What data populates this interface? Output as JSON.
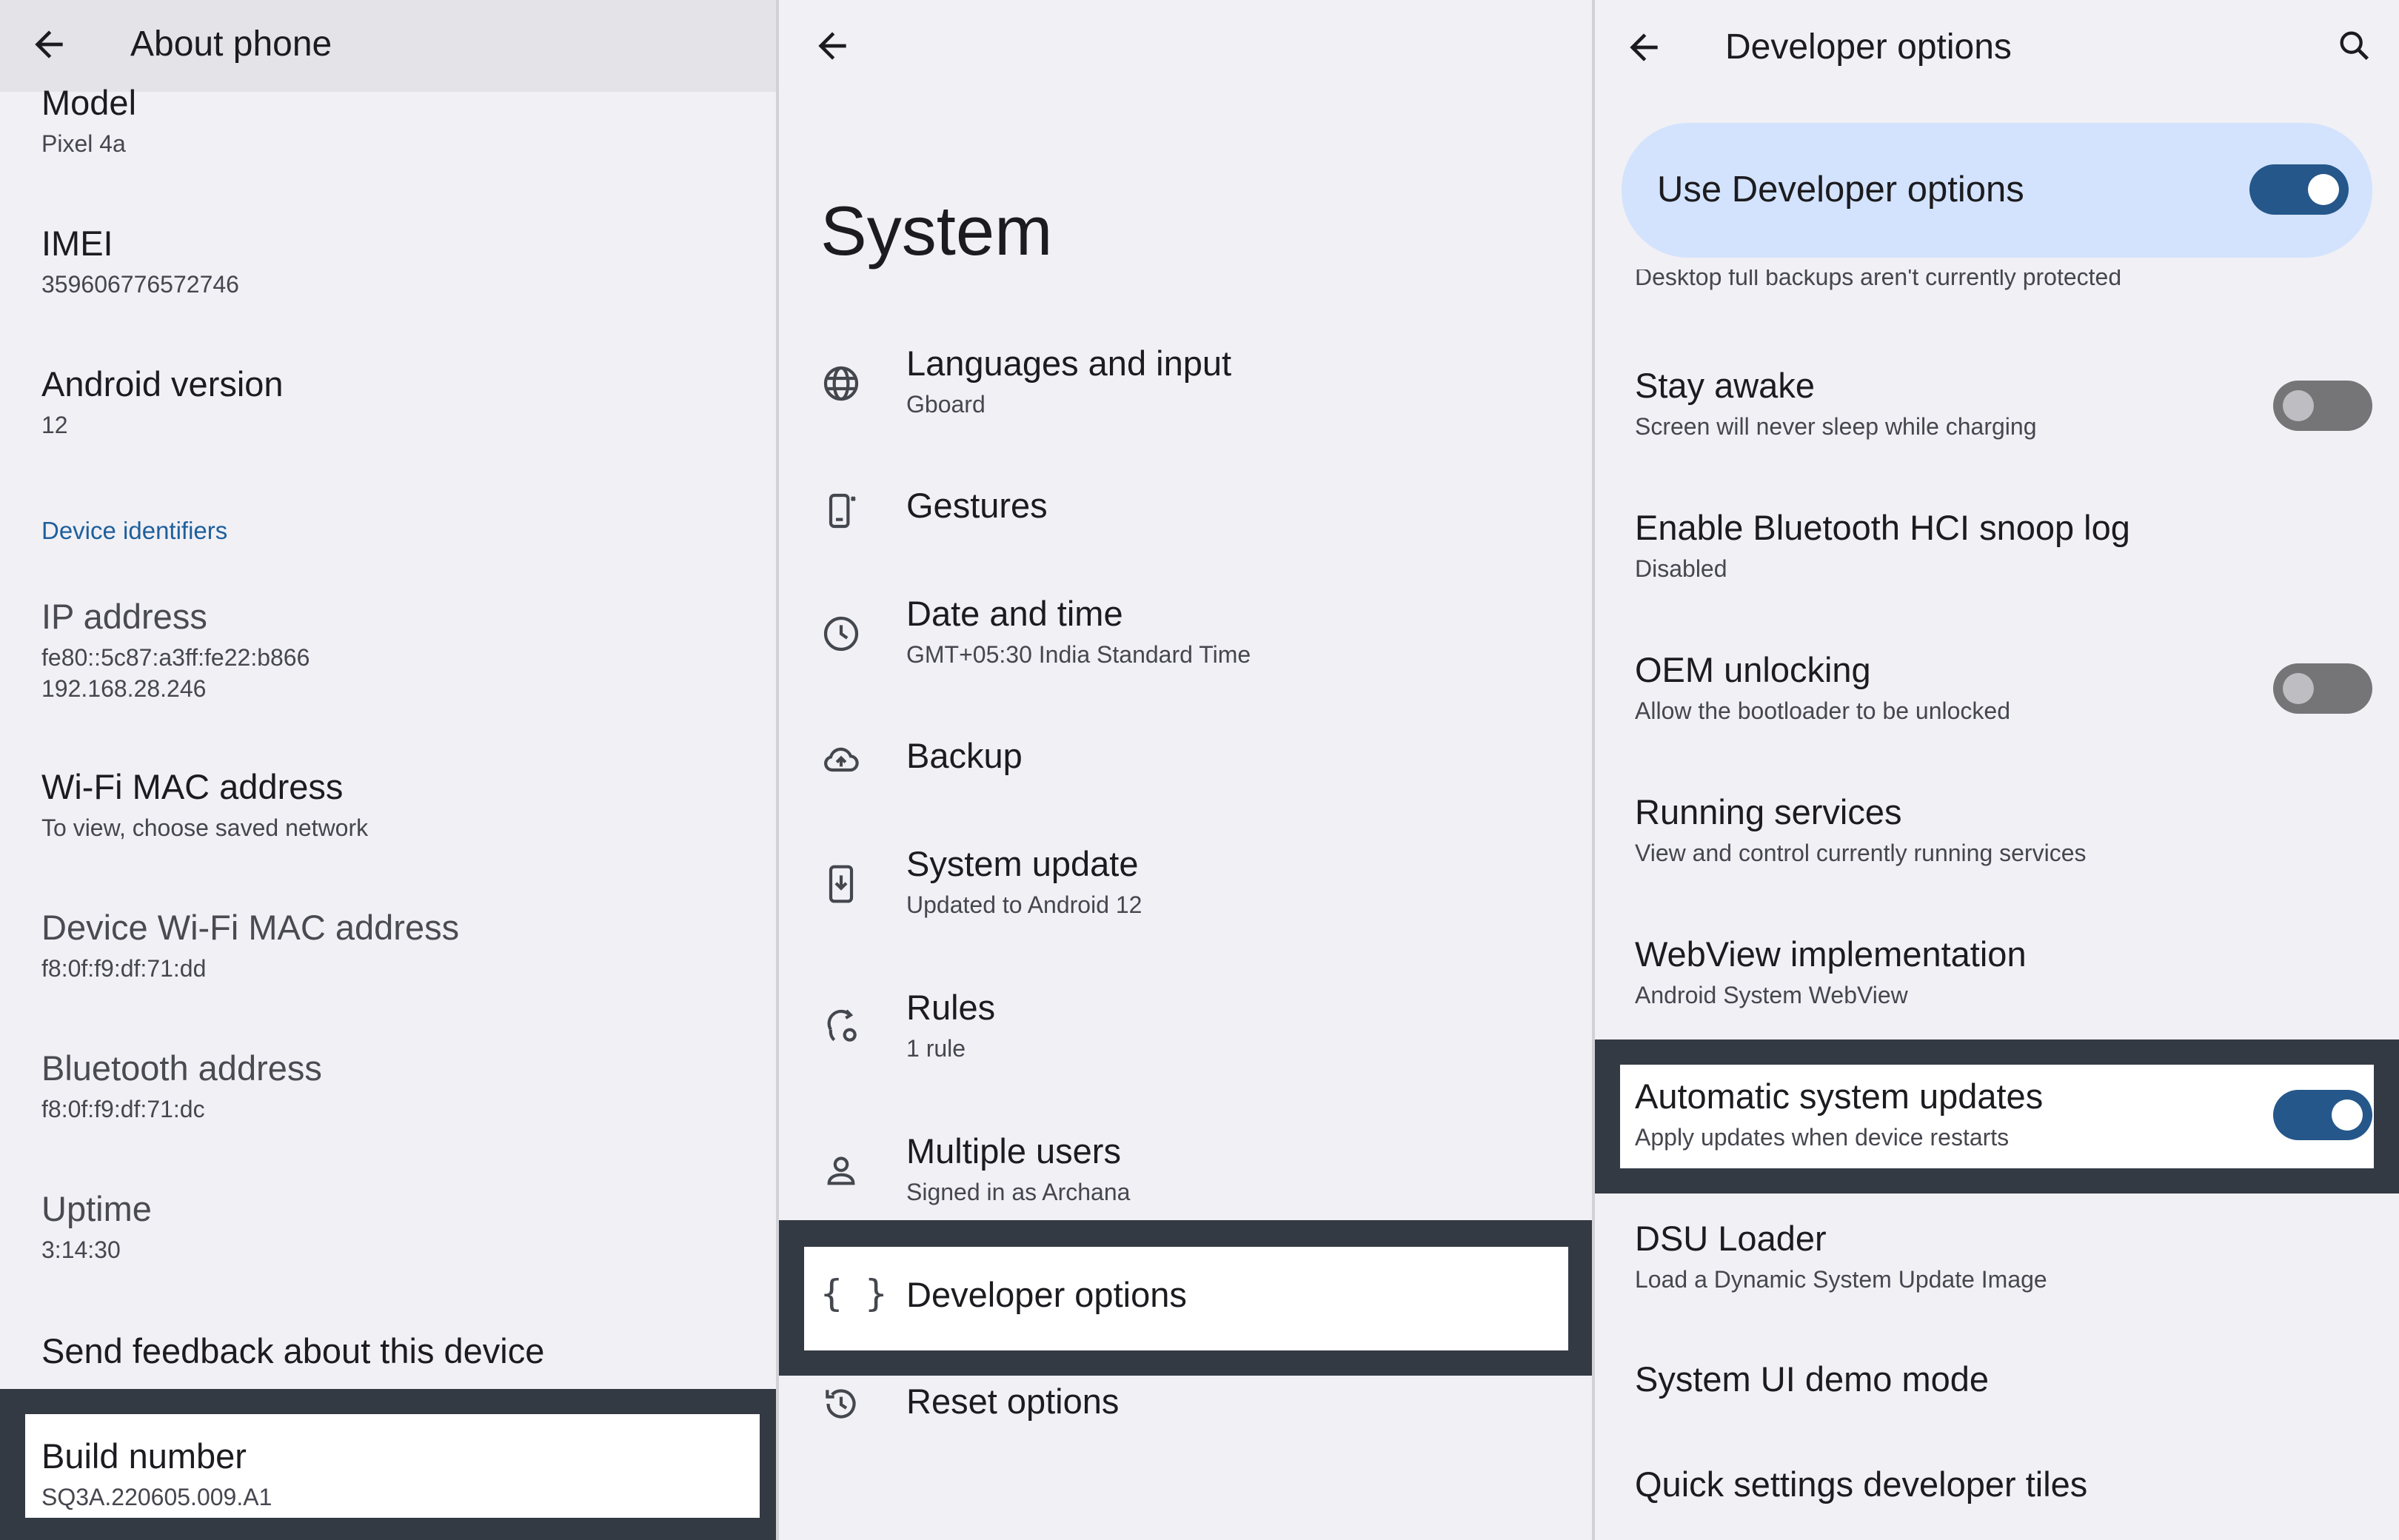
{
  "panel_about": {
    "title": "About phone",
    "items": [
      {
        "title": "Model",
        "subtitle": "Pixel 4a"
      },
      {
        "title": "IMEI",
        "subtitle": "359606776572746"
      },
      {
        "title": "Android version",
        "subtitle": "12"
      },
      {
        "title": "IP address",
        "subtitle": "fe80::5c87:a3ff:fe22:b866",
        "subtitle2": "192.168.28.246"
      },
      {
        "title": "Wi-Fi MAC address",
        "subtitle": "To view, choose saved network"
      },
      {
        "title": "Device Wi-Fi MAC address",
        "subtitle": "f8:0f:f9:df:71:dd"
      },
      {
        "title": "Bluetooth address",
        "subtitle": "f8:0f:f9:df:71:dc"
      },
      {
        "title": "Uptime",
        "subtitle": "3:14:30"
      },
      {
        "title": "Send feedback about this device"
      },
      {
        "title": "Build number",
        "subtitle": "SQ3A.220605.009.A1"
      }
    ],
    "section_header": "Device identifiers"
  },
  "panel_system": {
    "title": "System",
    "items": [
      {
        "title": "Languages and input",
        "subtitle": "Gboard",
        "icon": "globe-icon"
      },
      {
        "title": "Gestures",
        "icon": "phone-gesture-icon"
      },
      {
        "title": "Date and time",
        "subtitle": "GMT+05:30 India Standard Time",
        "icon": "clock-icon"
      },
      {
        "title": "Backup",
        "icon": "cloud-upload-icon"
      },
      {
        "title": "System update",
        "subtitle": "Updated to Android 12",
        "icon": "system-update-icon"
      },
      {
        "title": "Rules",
        "subtitle": "1 rule",
        "icon": "rules-icon"
      },
      {
        "title": "Multiple users",
        "subtitle": "Signed in as Archana",
        "icon": "person-icon"
      },
      {
        "title": "Developer options",
        "icon": "braces-icon"
      },
      {
        "title": "Reset options",
        "icon": "history-icon"
      }
    ]
  },
  "panel_dev": {
    "title": "Developer options",
    "use_label": "Use Developer options",
    "use_enabled": true,
    "cutoff_text": "Desktop full backups aren't currently protected",
    "items": [
      {
        "title": "Stay awake",
        "subtitle": "Screen will never sleep while charging",
        "toggle": false
      },
      {
        "title": "Enable Bluetooth HCI snoop log",
        "subtitle": "Disabled"
      },
      {
        "title": "OEM unlocking",
        "subtitle": "Allow the bootloader to be unlocked",
        "toggle": false
      },
      {
        "title": "Running services",
        "subtitle": "View and control currently running services"
      },
      {
        "title": "WebView implementation",
        "subtitle": "Android System WebView"
      },
      {
        "title": "Automatic system updates",
        "subtitle": "Apply updates when device restarts",
        "toggle": true
      },
      {
        "title": "DSU Loader",
        "subtitle": "Load a Dynamic System Update Image"
      },
      {
        "title": "System UI demo mode"
      },
      {
        "title": "Quick settings developer tiles"
      }
    ]
  }
}
